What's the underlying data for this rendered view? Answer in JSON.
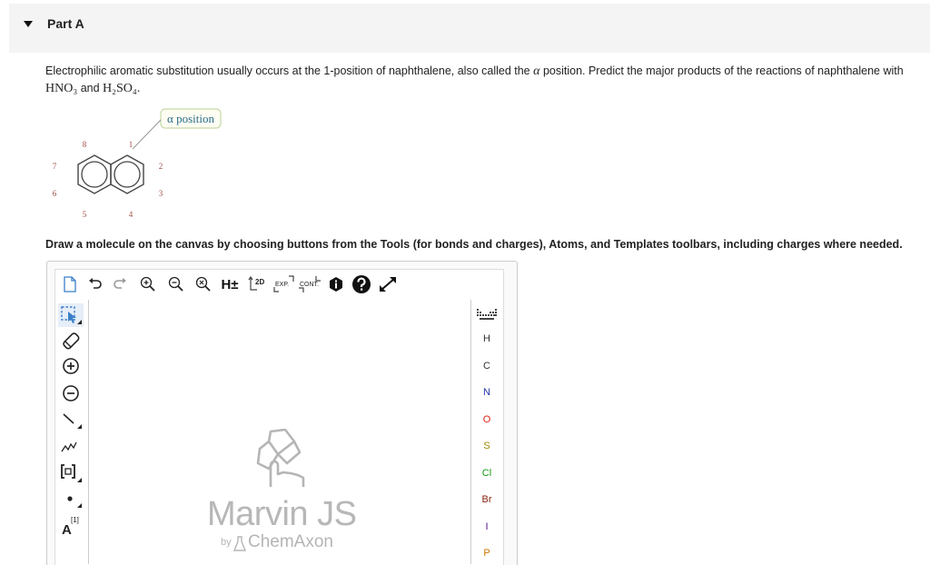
{
  "part": {
    "title": "Part A"
  },
  "question": {
    "text_before": "Electrophilic aromatic substitution usually occurs at the 1-position of naphthalene, also called the ",
    "alpha": "α",
    "text_after": " position. Predict the major products of the reactions of naphthalene with",
    "reagent1": "HNO₃",
    "and": " and ",
    "reagent2": "H₂SO₄",
    "period": "."
  },
  "figure": {
    "callout": "α position",
    "positions": [
      "8",
      "1",
      "2",
      "3",
      "4",
      "5",
      "6",
      "7"
    ]
  },
  "instruction": "Draw a molecule on the canvas by choosing buttons from the Tools (for bonds and charges), Atoms, and Templates toolbars, including charges where needed.",
  "editor": {
    "toolbar": {
      "hydrogen_label": "H±",
      "twod_label": "2D",
      "exp_label": "EXP.",
      "cont_label": "CONT."
    },
    "left_tools": {
      "atom_map_label": "A",
      "atom_map_index": "[1]"
    },
    "atoms": [
      "H",
      "C",
      "N",
      "O",
      "S",
      "Cl",
      "Br",
      "I",
      "P"
    ],
    "atom_colors": [
      "#333333",
      "#333333",
      "#2233aa",
      "#dd2211",
      "#a08a00",
      "#119911",
      "#882211",
      "#551188",
      "#cc7700"
    ],
    "watermark": {
      "name": "Marvin JS",
      "by": "by",
      "company": "ChemAxon"
    }
  }
}
